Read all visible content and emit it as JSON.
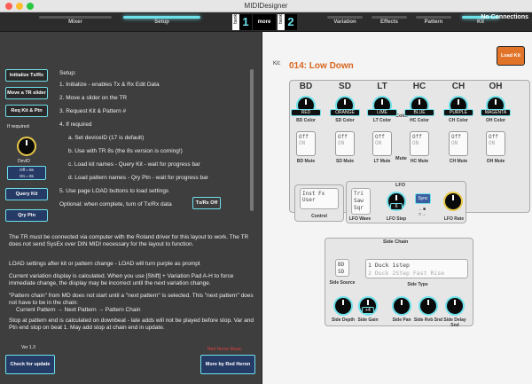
{
  "app": {
    "title": "MIDIDesigner"
  },
  "topbar": {
    "tabs": [
      {
        "label": "Mixer"
      },
      {
        "label": "Setup"
      },
      {
        "label": "Variation"
      },
      {
        "label": "Effects"
      },
      {
        "label": "Pattern"
      },
      {
        "label": "Kit"
      }
    ],
    "bank_word": "bank",
    "bank_left": "1",
    "bank_right": "2",
    "more": "more",
    "connection": "No Connections"
  },
  "left": {
    "buttons": {
      "init": "Initialize Tx/Rx",
      "move": "Move a TR slider",
      "req": "Req Kit & Ptn",
      "if_required": "If required",
      "devid": "DevID",
      "offon": "Off = 8s\nOn = 8s",
      "query_kit": "Query Kit",
      "qry_ptn": "Qry Ptn",
      "txrx_off": "Tx/Rx Off",
      "check_update": "Check for update",
      "more_heron": "More by Red Heron",
      "version": "Ver 1.3",
      "red_heron": "Red Heron Music"
    },
    "steps": {
      "setup": "Setup:",
      "s1": "1. Initialize - enables Tx & Rx Edit Data",
      "s2": "2. Move a slider on the TR",
      "s3": "3. Request Kit & Pattern #",
      "s4": "4. If required",
      "a": "a. Set deviceID (17 is default)",
      "b": "b. Use with TR 8s (the 8s version is coming!)",
      "c": "c. Load kit names - Query Kit - wait for progress bar",
      "d": "d. Load pattern names - Qry Ptn - wait for progress bar",
      "s5": "5. Use page LOAD buttons to load settings",
      "optional": "Optional: when complete, turn of Tx/Rx data"
    },
    "paragraphs": {
      "p1": "The TR must be connected via computer with the Roland driver for this layout to work.  The TR does not send SysEx over DIN MIDI necessary for the layout to function.",
      "p2": "LOAD settings after kit or pattern change - LOAD will turn purple as prompt",
      "p3": "Current variation display is calculated.  When you use [Shift] + Variation Pad A-H to force immediate change, the display may be incorrect until the next variation change.",
      "p4": "\"Pattern chain\" from MD does not start until a \"next pattern\" is selected.  This \"next pattern\" does not have to be in the chain:",
      "p4b": "Current Pattern → Next Pattern → Pattern Chain",
      "p5": "Stop at pattern end is calculated on downbeat - late adds will not be played before stop.  Var and Ptn end stop on beat 1.  May add stop at chain end in update."
    }
  },
  "right": {
    "kit_label": "Kit:",
    "kit_name": "014: Low Down",
    "load_kit": "Load Kit",
    "columns": [
      "BD",
      "SD",
      "LT",
      "HC",
      "CH",
      "OH"
    ],
    "colors": [
      "RED",
      "ORANGE",
      "LIME",
      "BLUE",
      "PURPLE",
      "MAGENTA"
    ],
    "color_labels": [
      "BD Color",
      "SD Color",
      "LT Color",
      "HC Color",
      "CH Color",
      "OH Color"
    ],
    "mute_labels": [
      "BD Mute",
      "SD Mute",
      "LT Mute",
      "HC Mute",
      "CH Mute",
      "OH Mute"
    ],
    "mute_opts": {
      "a": "Off",
      "b": "ON"
    },
    "group_color": "Color",
    "group_mute": "Mute",
    "control": {
      "opt1": "Inst Fx",
      "opt2": "User",
      "label": "Control"
    },
    "lfo": {
      "title": "LFO",
      "w1": "Tri",
      "w2": "Saw",
      "w3": "Sqr",
      "wave_label": "LFO Wave",
      "step_value": "6",
      "step_label": "LFO Step",
      "sync": "Sync",
      "rate_label": "LFO Rate"
    },
    "sidechain": {
      "title": "Side Chain",
      "src1": "BD",
      "src2": "SD",
      "src_label": "Side Source",
      "type1": "1 Duck 1step",
      "type2": "2 Duck 2Step Fast Rise",
      "type_label": "Side Type",
      "depth": "Side Depth",
      "gain": "Side Gain",
      "gain_val": "+4",
      "pan": "Side Pan",
      "rvb": "Side Rvb Snd",
      "delay": "Side Delay Snd"
    }
  }
}
